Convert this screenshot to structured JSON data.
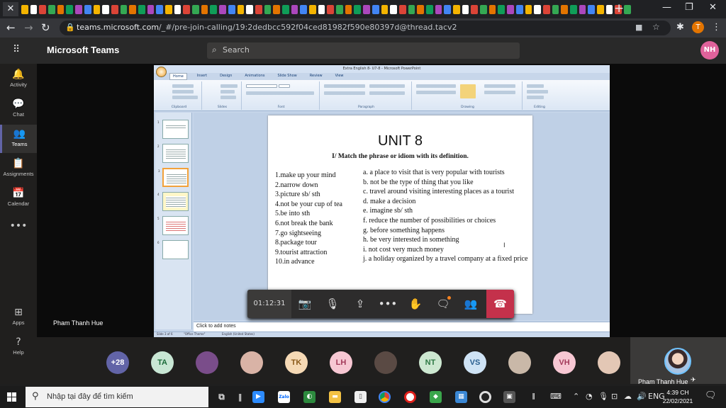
{
  "browser": {
    "close_tab_glyph": "✕",
    "new_tab_glyph": "+",
    "window_controls": [
      "—",
      "❐",
      "✕"
    ],
    "url_host": "teams.microsoft.com",
    "url_path": "/_#/pre-join-calling/19:2dedbcc592f04ced81982f590e80397d@thread.tacv2",
    "profile_initial": "T",
    "nav_glyphs": [
      "←",
      "→",
      "↻"
    ]
  },
  "teams": {
    "app_title": "Microsoft Teams",
    "search_placeholder": "Search",
    "user_initials": "NH",
    "rail": [
      {
        "label": "Activity",
        "icon": "bell-icon",
        "glyph": "🔔",
        "active": false
      },
      {
        "label": "Chat",
        "icon": "chat-icon",
        "glyph": "💬",
        "active": false
      },
      {
        "label": "Teams",
        "icon": "teams-icon",
        "glyph": "👥",
        "active": true
      },
      {
        "label": "Assignments",
        "icon": "assignments-icon",
        "glyph": "📋",
        "active": false
      },
      {
        "label": "Calendar",
        "icon": "calendar-icon",
        "glyph": "📅",
        "active": false
      },
      {
        "label": "",
        "icon": "more-icon",
        "glyph": "•••",
        "active": false
      },
      {
        "label": "Apps",
        "icon": "apps-icon",
        "glyph": "⊞",
        "active": false
      },
      {
        "label": "Help",
        "icon": "help-icon",
        "glyph": "?",
        "active": false
      }
    ],
    "presenter_name": "Pham Thanh Hue"
  },
  "powerpoint": {
    "window_title": "Extra English 8- U7-8 - Microsoft PowerPoint",
    "tabs": [
      "Home",
      "Insert",
      "Design",
      "Animations",
      "Slide Show",
      "Review",
      "View"
    ],
    "groups": [
      "Clipboard",
      "Slides",
      "Font",
      "Paragraph",
      "Drawing",
      "Editing"
    ],
    "notes_placeholder": "Click to add notes",
    "status_left": "Slide 3 of 6",
    "status_theme": "\"Office Theme\"",
    "status_lang": "English (United States)"
  },
  "slide": {
    "title": "UNIT 8",
    "subtitle": "I/ Match the phrase or idiom with its definition.",
    "phrases": [
      "1.make up your mind",
      "2.narrow down",
      "3.picture sb/ sth",
      "4.not be your cup of tea",
      "5.be into sth",
      "6.not break the bank",
      "7.go sightseeing",
      "8.package tour",
      "9.tourist attraction",
      "10.in advance"
    ],
    "definitions": [
      "a. a place to visit that is very popular with tourists",
      "b. not be the type of thing that you like",
      "c. travel around visiting interesting places as a tourist",
      "d. make a decision",
      "e. imagine sb/ sth",
      "f. reduce the number of possibilities or choices",
      "g. before something happens",
      "h. be very interested in something",
      "i. not cost very much money",
      "j. a holiday organized by a travel company at a fixed price"
    ]
  },
  "meeting": {
    "timer": "01:12:31",
    "controls": [
      {
        "name": "camera-off-button",
        "glyph": "📷"
      },
      {
        "name": "mic-off-button",
        "glyph": "🎙"
      },
      {
        "name": "share-button",
        "glyph": "⇪"
      },
      {
        "name": "more-actions-button",
        "glyph": "•••"
      },
      {
        "name": "raise-hand-button",
        "glyph": "✋"
      },
      {
        "name": "chat-button",
        "glyph": "🗨"
      },
      {
        "name": "participants-button",
        "glyph": "👥"
      }
    ],
    "hangup_glyph": "☎"
  },
  "participants": [
    {
      "label": "+28",
      "bg": "#6264a7",
      "fg": "#ffffff"
    },
    {
      "label": "TA",
      "bg": "#c8e6d4",
      "fg": "#1b6b3a"
    },
    {
      "label": "",
      "bg": "#7a4d8a",
      "fg": "#ffffff"
    },
    {
      "label": "",
      "bg": "#d9b3a6",
      "fg": "#ffffff"
    },
    {
      "label": "TK",
      "bg": "#f5d9b5",
      "fg": "#8a5a1a"
    },
    {
      "label": "LH",
      "bg": "#f7c7d3",
      "fg": "#a33a5a"
    },
    {
      "label": "",
      "bg": "#5a4a44",
      "fg": "#ffffff"
    },
    {
      "label": "NT",
      "bg": "#cde8d1",
      "fg": "#2f7a45"
    },
    {
      "label": "VS",
      "bg": "#cfe3f5",
      "fg": "#2a5f90"
    },
    {
      "label": "",
      "bg": "#c9b8a8",
      "fg": "#ffffff"
    },
    {
      "label": "VH",
      "bg": "#f7c7d3",
      "fg": "#a33a5a"
    },
    {
      "label": "",
      "bg": "#e3c7b5",
      "fg": "#ffffff"
    }
  ],
  "self_tile": {
    "name": "Pham Thanh Hue"
  },
  "taskbar": {
    "search_placeholder": "Nhập tại đây để tìm kiếm",
    "time": "4:39 CH",
    "date": "22/02/2021"
  },
  "colors": {
    "teams_accent": "#6264a7",
    "hangup": "#c4314b",
    "chrome_dark": "#202124"
  }
}
